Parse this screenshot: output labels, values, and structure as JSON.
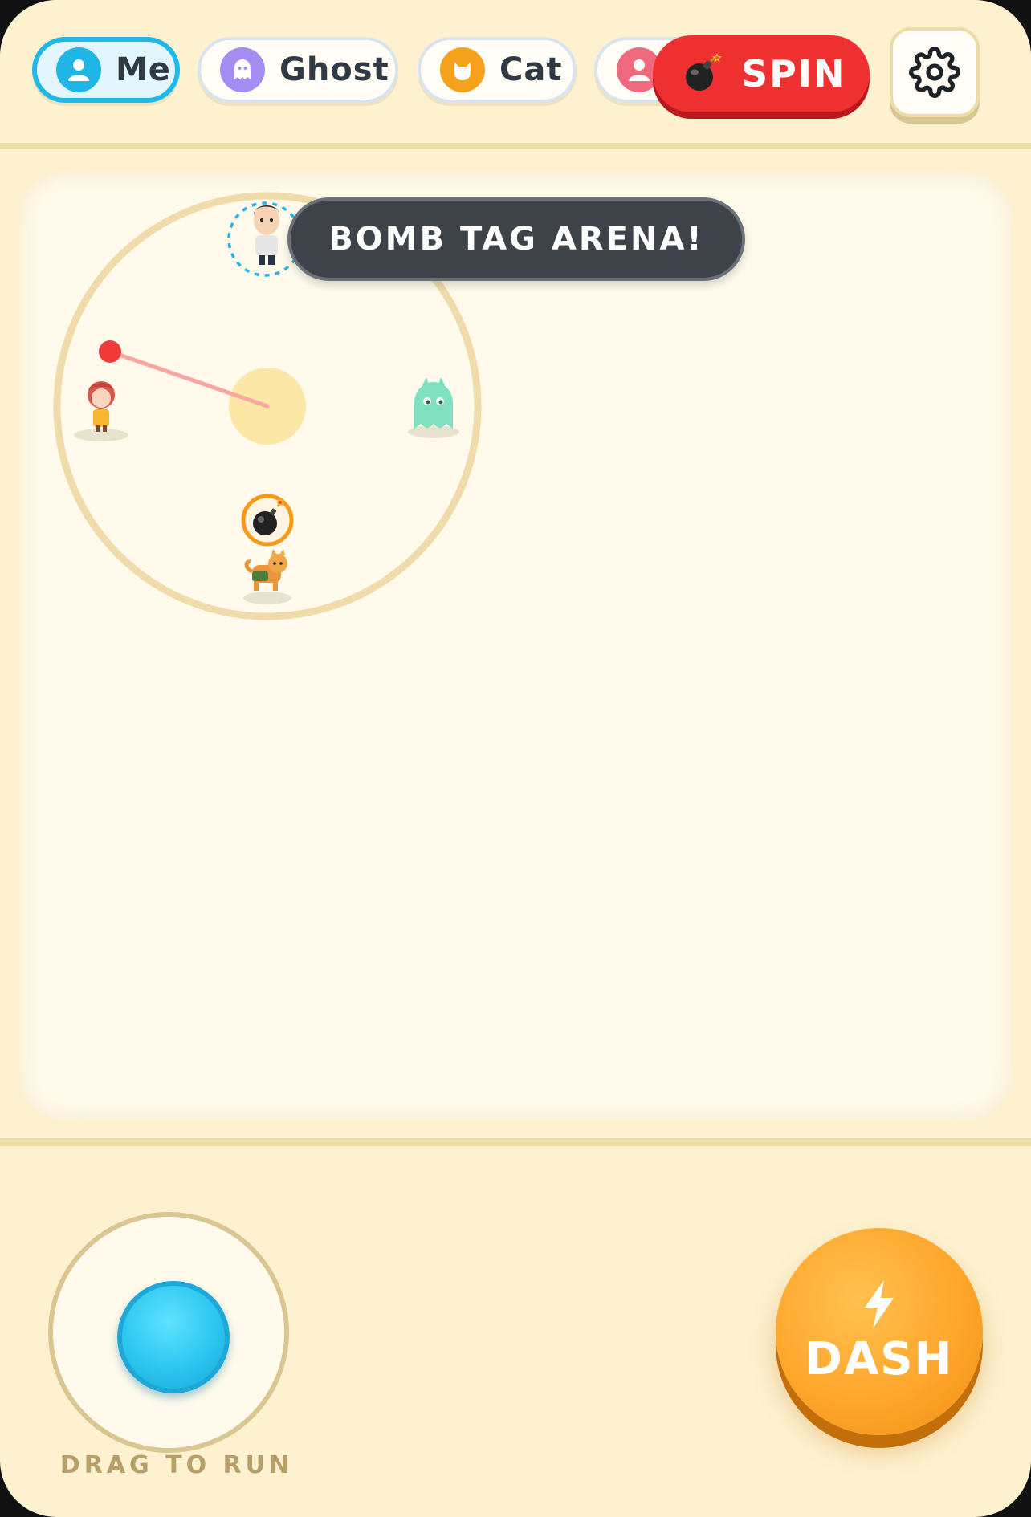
{
  "players": [
    {
      "label": "Me",
      "icon": "person-icon",
      "color": "#1fb6e6",
      "active": true
    },
    {
      "label": "Ghost",
      "icon": "ghost-icon",
      "color": "#a58cf0",
      "active": false
    },
    {
      "label": "Cat",
      "icon": "cat-icon",
      "color": "#f5a11c",
      "active": false
    },
    {
      "label": "",
      "icon": "person-icon",
      "color": "#f06a7e",
      "active": false
    }
  ],
  "spin": {
    "label": "SPIN",
    "icon": "bomb-icon",
    "color": "#ef3030"
  },
  "settings": {
    "icon": "gear-icon"
  },
  "arena": {
    "toast": "BOMB TAG ARENA!"
  },
  "controls": {
    "joystick_label": "DRAG TO RUN",
    "dash_label": "DASH",
    "dash_icon": "lightning-icon"
  },
  "colors": {
    "background": "#fdf1cf",
    "accent": "#20b8e8",
    "dash": "#ffa62c"
  }
}
